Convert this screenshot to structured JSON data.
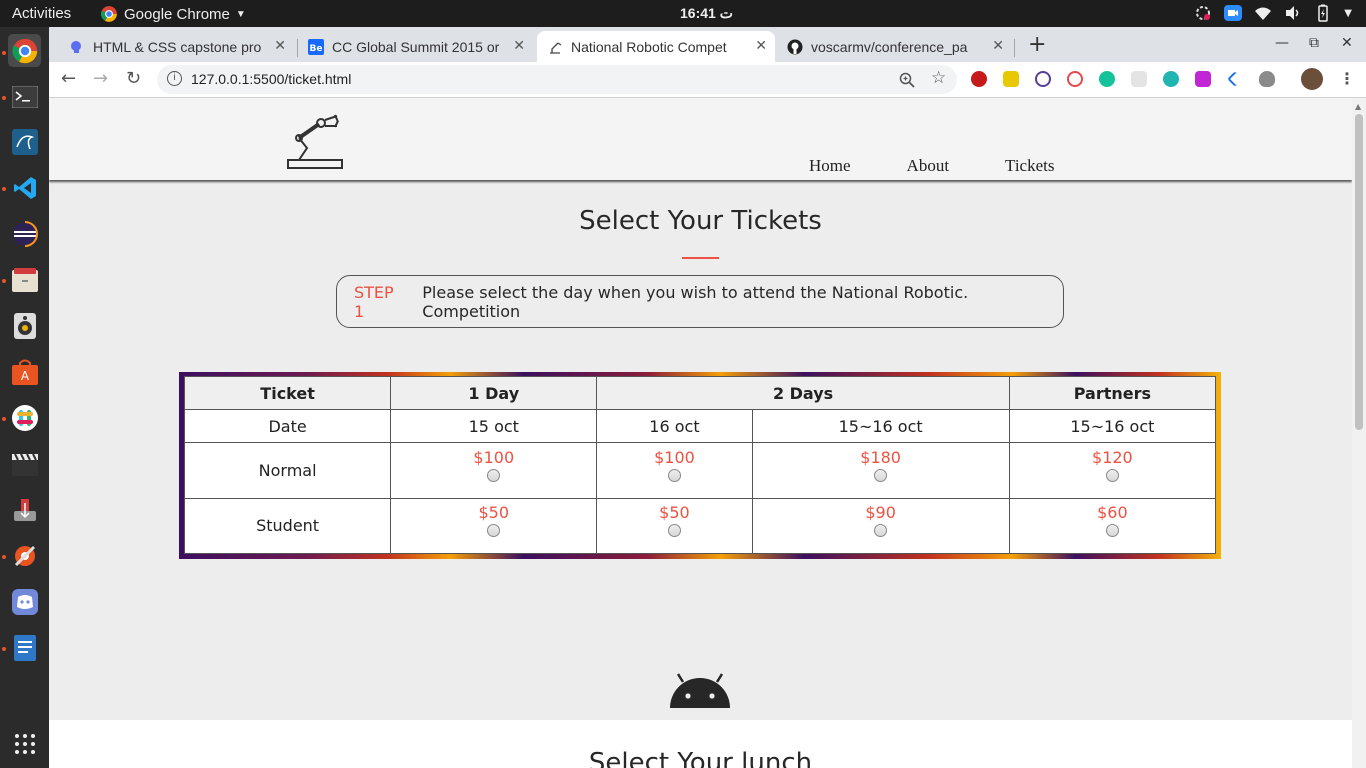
{
  "desktop": {
    "activities": "Activities",
    "app_name": "Google Chrome",
    "clock": "16:41 ت"
  },
  "browser": {
    "tabs": [
      {
        "title": "HTML & CSS capstone pro",
        "active": false
      },
      {
        "title": "CC Global Summit 2015 or",
        "active": false
      },
      {
        "title": "National Robotic Compet",
        "active": true
      },
      {
        "title": "voscarmv/conference_pa",
        "active": false
      }
    ],
    "new_tab": "+",
    "url": "127.0.0.1:5500/ticket.html"
  },
  "site": {
    "nav": [
      "Home",
      "About",
      "Tickets"
    ],
    "section_title": "Select Your Tickets",
    "step_label": "STEP 1",
    "step_text": "Please select the day when you wish to attend the National Robotic. Competition",
    "table": {
      "headers": [
        "Ticket",
        "1 Day",
        "2 Days",
        "Partners"
      ],
      "dates": [
        "Date",
        "15 oct",
        "16 oct",
        "15~16 oct",
        "15~16 oct"
      ],
      "rows": [
        {
          "label": "Normal",
          "prices": [
            "$100",
            "$100",
            "$180",
            "$120"
          ]
        },
        {
          "label": "Student",
          "prices": [
            "$50",
            "$50",
            "$90",
            "$60"
          ]
        }
      ]
    },
    "next_section_title": "Select Your lunch"
  },
  "colors": {
    "accent": "#ec5242",
    "text": "#272727",
    "background": "#ededed"
  }
}
